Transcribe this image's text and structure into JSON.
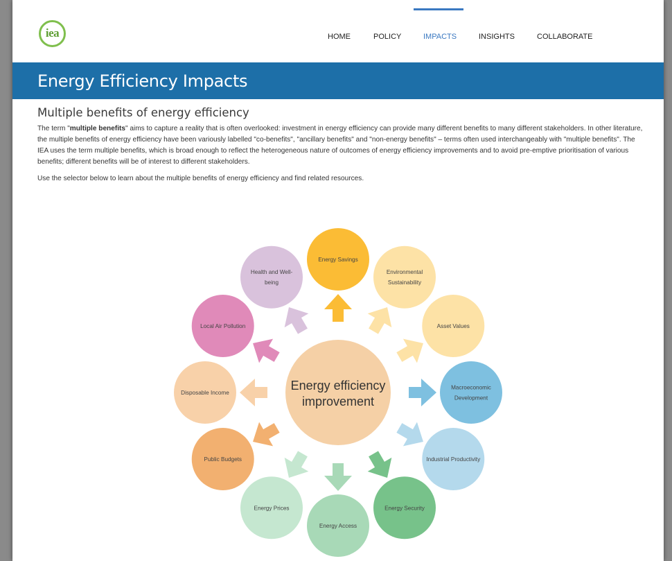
{
  "logo": {
    "text": "iea"
  },
  "nav": {
    "items": [
      "HOME",
      "POLICY",
      "IMPACTS",
      "INSIGHTS",
      "COLLABORATE"
    ],
    "active": "IMPACTS"
  },
  "banner": {
    "title": "Energy Efficiency Impacts"
  },
  "section": {
    "heading": "Multiple benefits of energy efficiency",
    "p1_start": "The term \"",
    "p1_bold": "multiple benefits",
    "p1_rest": "\" aims to capture a reality that is often overlooked: investment in energy efficiency can provide many different benefits to many different stakeholders. In other literature, the multiple benefits of energy efficiency have been variously labelled \"co-benefits\", \"ancillary benefits\" and \"non-energy benefits\" – terms often used interchangeably with \"multiple benefits\". The IEA uses the term multiple benefits, which is broad enough to reflect the heterogeneous nature of outcomes of energy efficiency improvements and to avoid pre-emptive prioritisation of various benefits; different benefits will be of interest to different stakeholders.",
    "p2": "Use the selector below to learn about the multiple benefits of energy efficiency and find related resources."
  },
  "diagram": {
    "center": {
      "line1": "Energy efficiency",
      "line2": "improvement",
      "color": "#f5d0a6"
    },
    "benefits": [
      {
        "lines": [
          "Energy Savings"
        ],
        "color": "#fbbc35",
        "arrow": "#fbbc35",
        "icon": "energy-savings"
      },
      {
        "lines": [
          "Environmental",
          "Sustainability"
        ],
        "color": "#fde2a6",
        "arrow": "#fde2a6",
        "icon": "environmental-sustainability"
      },
      {
        "lines": [
          "Asset Values"
        ],
        "color": "#fde2a6",
        "arrow": "#fde2a6",
        "icon": "asset-values"
      },
      {
        "lines": [
          "Macroeconomic",
          "Development"
        ],
        "color": "#7ec0e0",
        "arrow": "#7ec0e0",
        "icon": "macroeconomic-development"
      },
      {
        "lines": [
          "Industrial Productivity"
        ],
        "color": "#b4d9ec",
        "arrow": "#b4d9ec",
        "icon": "industrial-productivity"
      },
      {
        "lines": [
          "Energy Security"
        ],
        "color": "#77c28a",
        "arrow": "#77c28a",
        "icon": "energy-security"
      },
      {
        "lines": [
          "Energy Access"
        ],
        "color": "#a8d9b7",
        "arrow": "#a8d9b7",
        "icon": "energy-access"
      },
      {
        "lines": [
          "Energy Prices"
        ],
        "color": "#c5e7d0",
        "arrow": "#c5e7d0",
        "icon": "energy-prices"
      },
      {
        "lines": [
          "Public Budgets"
        ],
        "color": "#f2b070",
        "arrow": "#f2b070",
        "icon": "public-budgets"
      },
      {
        "lines": [
          "Disposable Income"
        ],
        "color": "#f8d1a9",
        "arrow": "#f8d1a9",
        "icon": "disposable-income"
      },
      {
        "lines": [
          "Local Air Pollution"
        ],
        "color": "#e08ab9",
        "arrow": "#e08ab9",
        "icon": "local-air-pollution"
      },
      {
        "lines": [
          "Health and Well-",
          "being"
        ],
        "color": "#d9c2dc",
        "arrow": "#d9c2dc",
        "icon": "health-and-well-being"
      }
    ]
  }
}
